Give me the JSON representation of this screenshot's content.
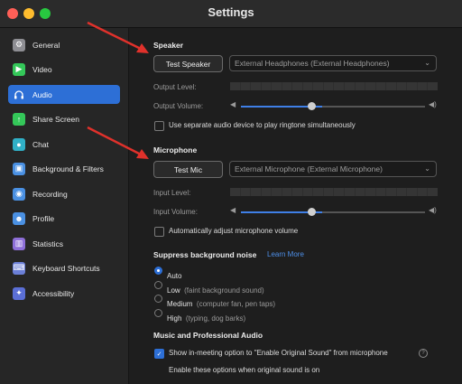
{
  "window": {
    "title": "Settings"
  },
  "sidebar": {
    "items": [
      {
        "label": "General",
        "icon": "gear-icon",
        "color": "#8e8e93"
      },
      {
        "label": "Video",
        "icon": "video-icon",
        "color": "#34c759"
      },
      {
        "label": "Audio",
        "icon": "headphones-icon",
        "color": "#2d6fd6",
        "active": true
      },
      {
        "label": "Share Screen",
        "icon": "share-screen-icon",
        "color": "#34c759"
      },
      {
        "label": "Chat",
        "icon": "chat-icon",
        "color": "#30b0c7"
      },
      {
        "label": "Background & Filters",
        "icon": "background-icon",
        "color": "#4a90e2"
      },
      {
        "label": "Recording",
        "icon": "recording-icon",
        "color": "#4a90e2"
      },
      {
        "label": "Profile",
        "icon": "profile-icon",
        "color": "#4a90e2"
      },
      {
        "label": "Statistics",
        "icon": "statistics-icon",
        "color": "#8e6fd8"
      },
      {
        "label": "Keyboard Shortcuts",
        "icon": "keyboard-icon",
        "color": "#6b7fd7"
      },
      {
        "label": "Accessibility",
        "icon": "accessibility-icon",
        "color": "#5b6fd6"
      }
    ]
  },
  "speaker": {
    "heading": "Speaker",
    "test_button": "Test Speaker",
    "device": "External Headphones (External Headphones)",
    "output_level_label": "Output Level:",
    "output_volume_label": "Output Volume:",
    "volume": 0.44,
    "separate_device_label": "Use separate audio device to play ringtone simultaneously",
    "separate_device_checked": false
  },
  "microphone": {
    "heading": "Microphone",
    "test_button": "Test Mic",
    "device": "External Microphone (External Microphone)",
    "input_level_label": "Input Level:",
    "input_volume_label": "Input Volume:",
    "volume": 0.44,
    "auto_adjust_label": "Automatically adjust microphone volume",
    "auto_adjust_checked": false
  },
  "noise": {
    "heading": "Suppress background noise",
    "learn_more": "Learn More",
    "options": [
      {
        "label": "Auto",
        "sub": "",
        "selected": true
      },
      {
        "label": "Low",
        "sub": "(faint background sound)",
        "selected": false
      },
      {
        "label": "Medium",
        "sub": "(computer fan, pen taps)",
        "selected": false
      },
      {
        "label": "High",
        "sub": "(typing, dog barks)",
        "selected": false
      }
    ]
  },
  "pro_audio": {
    "heading": "Music and Professional Audio",
    "original_sound_label": "Show in-meeting option to \"Enable Original Sound\" from microphone",
    "original_sound_checked": true,
    "note": "Enable these options when original sound is on"
  },
  "colors": {
    "accent": "#2d6fd6",
    "annotation_arrow": "#e0312b"
  }
}
